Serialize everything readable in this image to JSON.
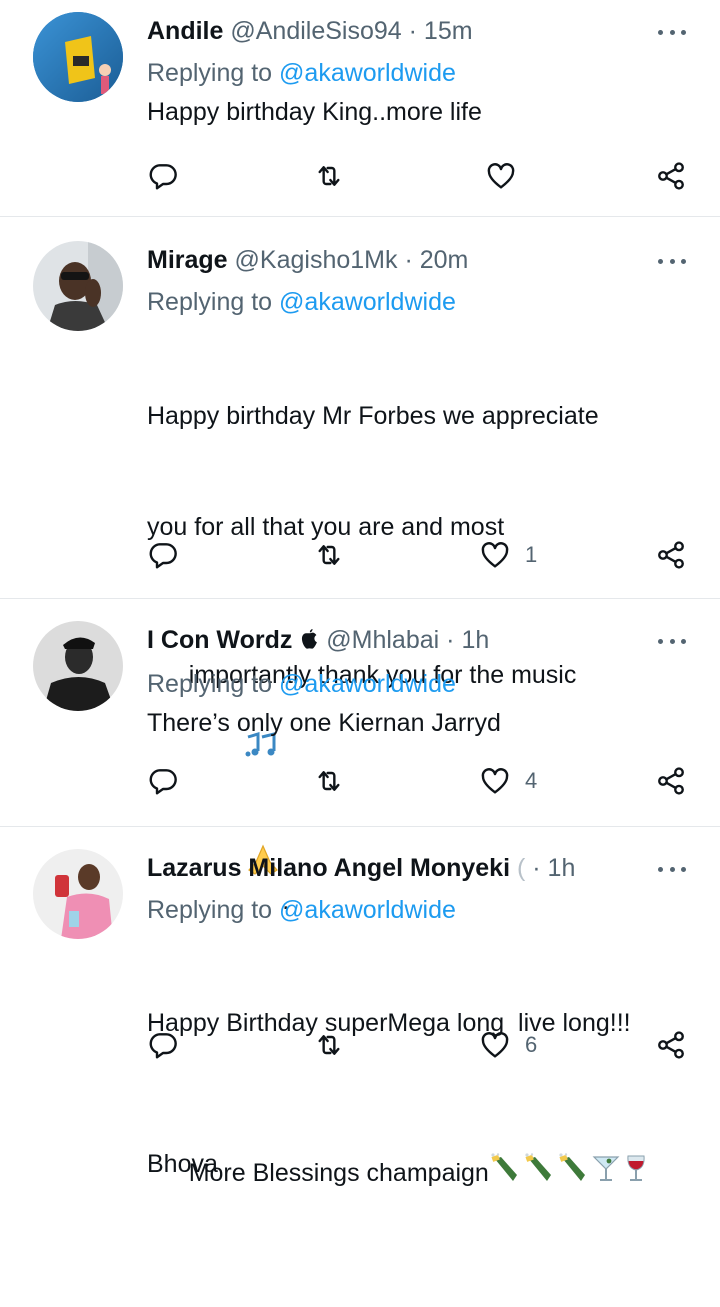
{
  "replies": [
    {
      "name": "Andile",
      "handle": "@AndileSiso94",
      "sep": "·",
      "time": "15m",
      "replying_prefix": "Replying to ",
      "replying_to": "@akaworldwide",
      "text": "Happy birthday King..more life",
      "likes": ""
    },
    {
      "name": "Mirage",
      "handle": "@Kagisho1Mk",
      "sep": "·",
      "time": "20m",
      "replying_prefix": "Replying to ",
      "replying_to": "@akaworldwide",
      "text_lines": [
        "Happy birthday Mr Forbes we appreciate",
        "you for all that you are and most",
        "importantly thank you for the music"
      ],
      "text_end": ".",
      "text_sign": "Bhova",
      "emojis": [
        "musical-notes-emoji",
        "folded-hands-emoji"
      ],
      "likes": "1"
    },
    {
      "name": "I Con Wordz",
      "handle": "@Mhlabai",
      "sep": "·",
      "time": "1h",
      "replying_prefix": "Replying to ",
      "replying_to": "@akaworldwide",
      "text": "There’s only one Kiernan Jarryd",
      "likes": "4"
    },
    {
      "name": "Lazarus Milano Angel Monyeki",
      "handle": "(",
      "sep": "·",
      "time": "1h",
      "replying_prefix": "Replying to ",
      "replying_to": "@akaworldwide",
      "text_line1": "Happy Birthday superMega long  live long!!!",
      "text_line2": "More Blessings champaign",
      "emojis": [
        "champagne-emoji",
        "champagne-emoji",
        "champagne-emoji",
        "cocktail-emoji",
        "wine-glass-emoji"
      ],
      "likes": "6"
    }
  ],
  "colors": {
    "text": "#0f1419",
    "secondary": "#536471",
    "link": "#1d9bf0",
    "divider": "#e5e8eb"
  },
  "icons": [
    "reply-icon",
    "retweet-icon",
    "like-icon",
    "share-icon",
    "more-icon",
    "apple-icon"
  ]
}
